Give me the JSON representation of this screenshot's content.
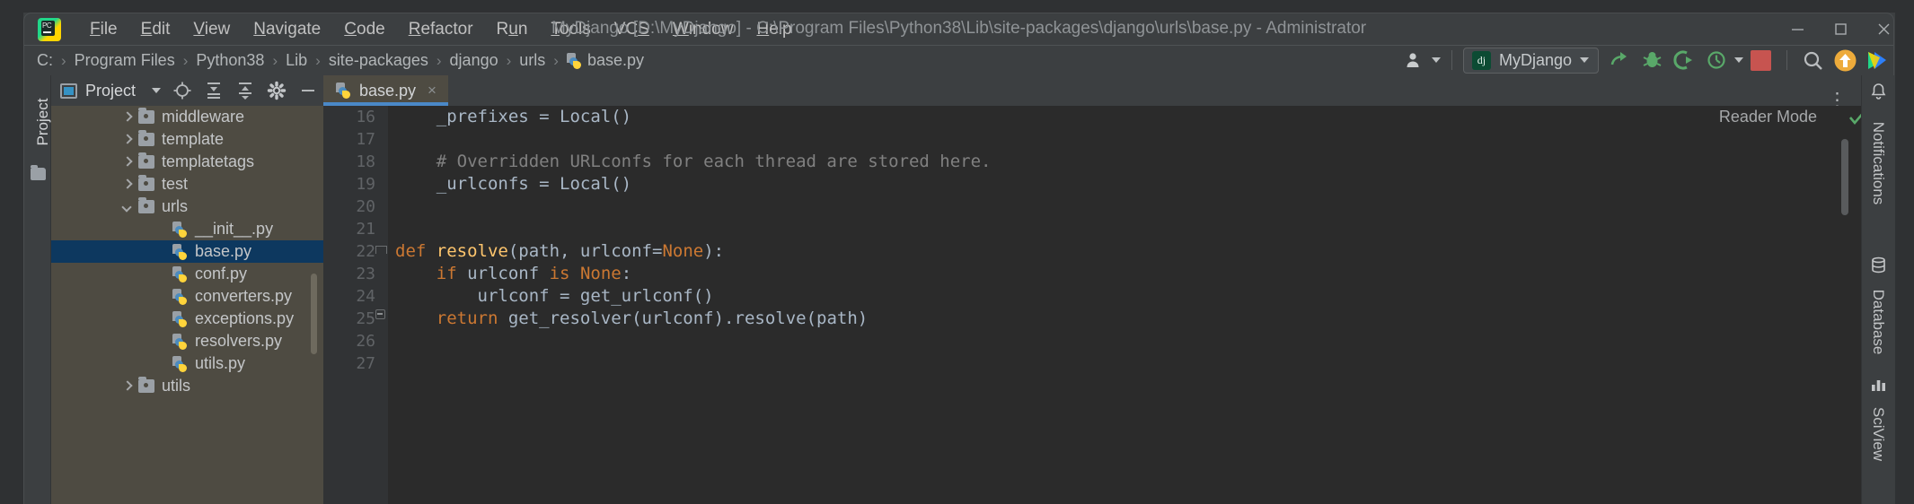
{
  "window": {
    "title": "MyDjango [D:\\MyDjango] - C:\\Program Files\\Python38\\Lib\\site-packages\\django\\urls\\base.py - Administrator",
    "app_logo": "pycharm-logo",
    "controls": {
      "minimize": "minimize-button",
      "maximize": "maximize-button",
      "close": "close-button"
    }
  },
  "menubar": {
    "items": [
      {
        "label": "File",
        "mnemonic": "F"
      },
      {
        "label": "Edit",
        "mnemonic": "E"
      },
      {
        "label": "View",
        "mnemonic": "V"
      },
      {
        "label": "Navigate",
        "mnemonic": "N"
      },
      {
        "label": "Code",
        "mnemonic": "C"
      },
      {
        "label": "Refactor",
        "mnemonic": "R"
      },
      {
        "label": "Run",
        "mnemonic": "u"
      },
      {
        "label": "Tools",
        "mnemonic": "T"
      },
      {
        "label": "VCS",
        "mnemonic": "S"
      },
      {
        "label": "Window",
        "mnemonic": "W"
      },
      {
        "label": "Help",
        "mnemonic": "H"
      }
    ]
  },
  "navbar": {
    "crumbs": [
      {
        "label": "C:",
        "icon": ""
      },
      {
        "label": "Program Files",
        "icon": ""
      },
      {
        "label": "Python38",
        "icon": ""
      },
      {
        "label": "Lib",
        "icon": ""
      },
      {
        "label": "site-packages",
        "icon": ""
      },
      {
        "label": "django",
        "icon": ""
      },
      {
        "label": "urls",
        "icon": ""
      },
      {
        "label": "base.py",
        "icon": "python-file-icon"
      }
    ],
    "separator": "›"
  },
  "toolbar": {
    "user_icon": "user-avatar-icon",
    "run_config": {
      "label": "MyDjango",
      "icon_text": "dj",
      "icon_name": "django-icon"
    },
    "actions": [
      {
        "name": "run-button",
        "color": "#59a869"
      },
      {
        "name": "debug-button",
        "color": "#59a869"
      },
      {
        "name": "run-coverage-button",
        "color": "#59a869"
      },
      {
        "name": "profile-button",
        "color": "#59a869"
      },
      {
        "name": "stop-button",
        "color": "#c75450"
      },
      {
        "name": "search-everywhere-button",
        "color": "#a6a8aa"
      },
      {
        "name": "update-project-button",
        "color": "#edab3b"
      },
      {
        "name": "ide-logo",
        "color": "#21d789"
      }
    ]
  },
  "left_strip": {
    "tab_label": "Project",
    "folder_icon": "folder-icon"
  },
  "project_panel": {
    "title": "Project",
    "header_icons": [
      "project-view-icon",
      "chevron-down-icon",
      "locate-icon",
      "expand-all-icon",
      "collapse-all-icon",
      "settings-icon",
      "hide-icon"
    ],
    "tree": [
      {
        "label": "middleware",
        "type": "folder",
        "indent": 4,
        "state": "collapsed",
        "selected": false
      },
      {
        "label": "template",
        "type": "folder",
        "indent": 4,
        "state": "collapsed",
        "selected": false
      },
      {
        "label": "templatetags",
        "type": "folder",
        "indent": 4,
        "state": "collapsed",
        "selected": false
      },
      {
        "label": "test",
        "type": "folder",
        "indent": 4,
        "state": "collapsed",
        "selected": false
      },
      {
        "label": "urls",
        "type": "folder",
        "indent": 4,
        "state": "expanded",
        "selected": false
      },
      {
        "label": "__init__.py",
        "type": "python",
        "indent": 6,
        "state": "none",
        "selected": false
      },
      {
        "label": "base.py",
        "type": "python",
        "indent": 6,
        "state": "none",
        "selected": true
      },
      {
        "label": "conf.py",
        "type": "python",
        "indent": 6,
        "state": "none",
        "selected": false
      },
      {
        "label": "converters.py",
        "type": "python",
        "indent": 6,
        "state": "none",
        "selected": false
      },
      {
        "label": "exceptions.py",
        "type": "python",
        "indent": 6,
        "state": "none",
        "selected": false
      },
      {
        "label": "resolvers.py",
        "type": "python",
        "indent": 6,
        "state": "none",
        "selected": false
      },
      {
        "label": "utils.py",
        "type": "python",
        "indent": 6,
        "state": "none",
        "selected": false
      },
      {
        "label": "utils",
        "type": "folder",
        "indent": 4,
        "state": "collapsed",
        "selected": false
      }
    ]
  },
  "editor": {
    "tabs": [
      {
        "label": "base.py",
        "icon": "python-file-icon",
        "active": true,
        "close": "×"
      }
    ],
    "tabs_more_icon": "more-options-icon",
    "reader_mode_label": "Reader Mode",
    "inspection_status_icon": "inspection-ok-icon",
    "lines": [
      {
        "number": "16",
        "segments": [
          {
            "t": "    _prefixes = Local()",
            "c": ""
          }
        ]
      },
      {
        "number": "17",
        "segments": [
          {
            "t": "",
            "c": ""
          }
        ]
      },
      {
        "number": "18",
        "segments": [
          {
            "t": "    # Overridden URLconfs for each thread are stored here.",
            "c": "cm"
          }
        ]
      },
      {
        "number": "19",
        "segments": [
          {
            "t": "    _urlconfs = Local()",
            "c": ""
          }
        ]
      },
      {
        "number": "20",
        "segments": [
          {
            "t": "",
            "c": ""
          }
        ]
      },
      {
        "number": "21",
        "segments": [
          {
            "t": "",
            "c": ""
          }
        ]
      },
      {
        "number": "22",
        "segments": [
          {
            "t": "def ",
            "c": "kw"
          },
          {
            "t": "resolve",
            "c": "fn"
          },
          {
            "t": "(path, urlconf=",
            "c": ""
          },
          {
            "t": "None",
            "c": "kw"
          },
          {
            "t": "):",
            "c": ""
          }
        ]
      },
      {
        "number": "23",
        "segments": [
          {
            "t": "    ",
            "c": ""
          },
          {
            "t": "if ",
            "c": "kw"
          },
          {
            "t": "urlconf ",
            "c": ""
          },
          {
            "t": "is ",
            "c": "kw"
          },
          {
            "t": "None",
            "c": "kw"
          },
          {
            "t": ":",
            "c": ""
          }
        ]
      },
      {
        "number": "24",
        "segments": [
          {
            "t": "        urlconf = get_urlconf()",
            "c": ""
          }
        ]
      },
      {
        "number": "25",
        "segments": [
          {
            "t": "    ",
            "c": ""
          },
          {
            "t": "return ",
            "c": "kw"
          },
          {
            "t": "get_resolver(urlconf).resolve(path)",
            "c": ""
          }
        ]
      },
      {
        "number": "26",
        "segments": [
          {
            "t": "",
            "c": ""
          }
        ]
      },
      {
        "number": "27",
        "segments": [
          {
            "t": "",
            "c": ""
          }
        ]
      }
    ]
  },
  "right_strip": {
    "tabs": [
      {
        "label": "Notifications",
        "icon": "bell-icon"
      },
      {
        "label": "Database",
        "icon": "database-icon"
      },
      {
        "label": "SciView",
        "icon": "chart-icon"
      }
    ]
  }
}
